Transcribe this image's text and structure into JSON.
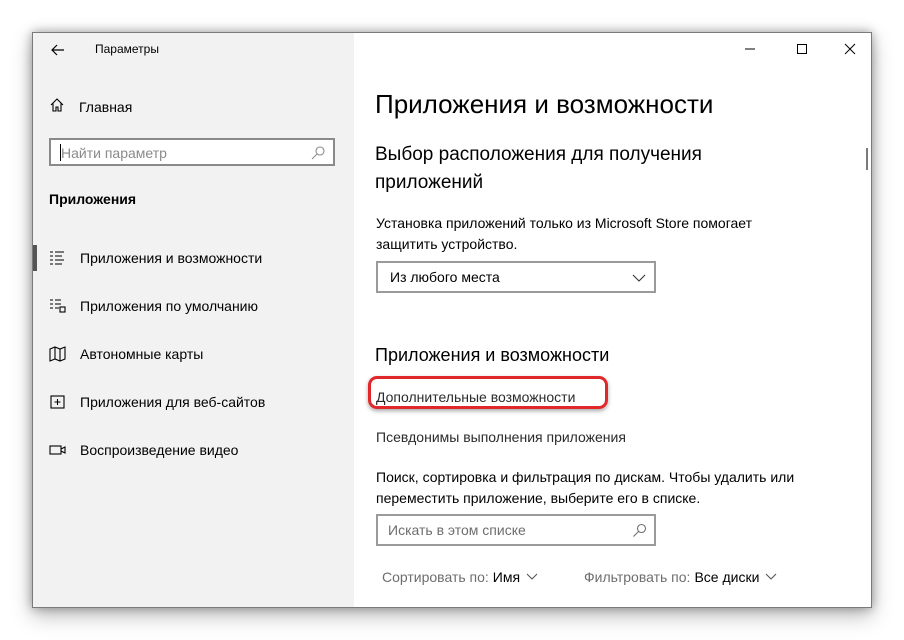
{
  "titlebar": {
    "title": "Параметры",
    "back_icon": "back-arrow-icon",
    "controls": [
      "minimize-icon",
      "maximize-icon",
      "close-icon"
    ]
  },
  "sidebar": {
    "home_label": "Главная",
    "search_placeholder": "Найти параметр",
    "section_title": "Приложения",
    "items": [
      {
        "label": "Приложения и возможности",
        "icon": "apps-features-icon",
        "active": true
      },
      {
        "label": "Приложения по умолчанию",
        "icon": "default-apps-icon",
        "active": false
      },
      {
        "label": "Автономные карты",
        "icon": "offline-maps-icon",
        "active": false
      },
      {
        "label": "Приложения для веб-сайтов",
        "icon": "apps-for-websites-icon",
        "active": false
      },
      {
        "label": "Воспроизведение видео",
        "icon": "video-playback-icon",
        "active": false
      }
    ]
  },
  "main": {
    "page_title": "Приложения и возможности",
    "install_section": {
      "heading_line1": "Выбор расположения для получения",
      "heading_line2": "приложений",
      "desc_line1": "Установка приложений только из Microsoft Store помогает",
      "desc_line2": "защитить устройство.",
      "dropdown_value": "Из любого места"
    },
    "apps_section": {
      "heading": "Приложения и возможности",
      "link_optional": "Дополнительные возможности",
      "link_aliases": "Псевдонимы выполнения приложения",
      "desc_line1": "Поиск, сортировка и фильтрация по дискам. Чтобы удалить или",
      "desc_line2": "переместить приложение, выберите его в списке.",
      "search_placeholder": "Искать в этом списке",
      "sort_label": "Сортировать по:",
      "sort_value": "Имя",
      "filter_label": "Фильтровать по:",
      "filter_value": "Все диски"
    }
  },
  "colors": {
    "sidebar_bg": "#f2f2f2",
    "highlight": "#e0282b",
    "active_indicator": "#555555"
  }
}
